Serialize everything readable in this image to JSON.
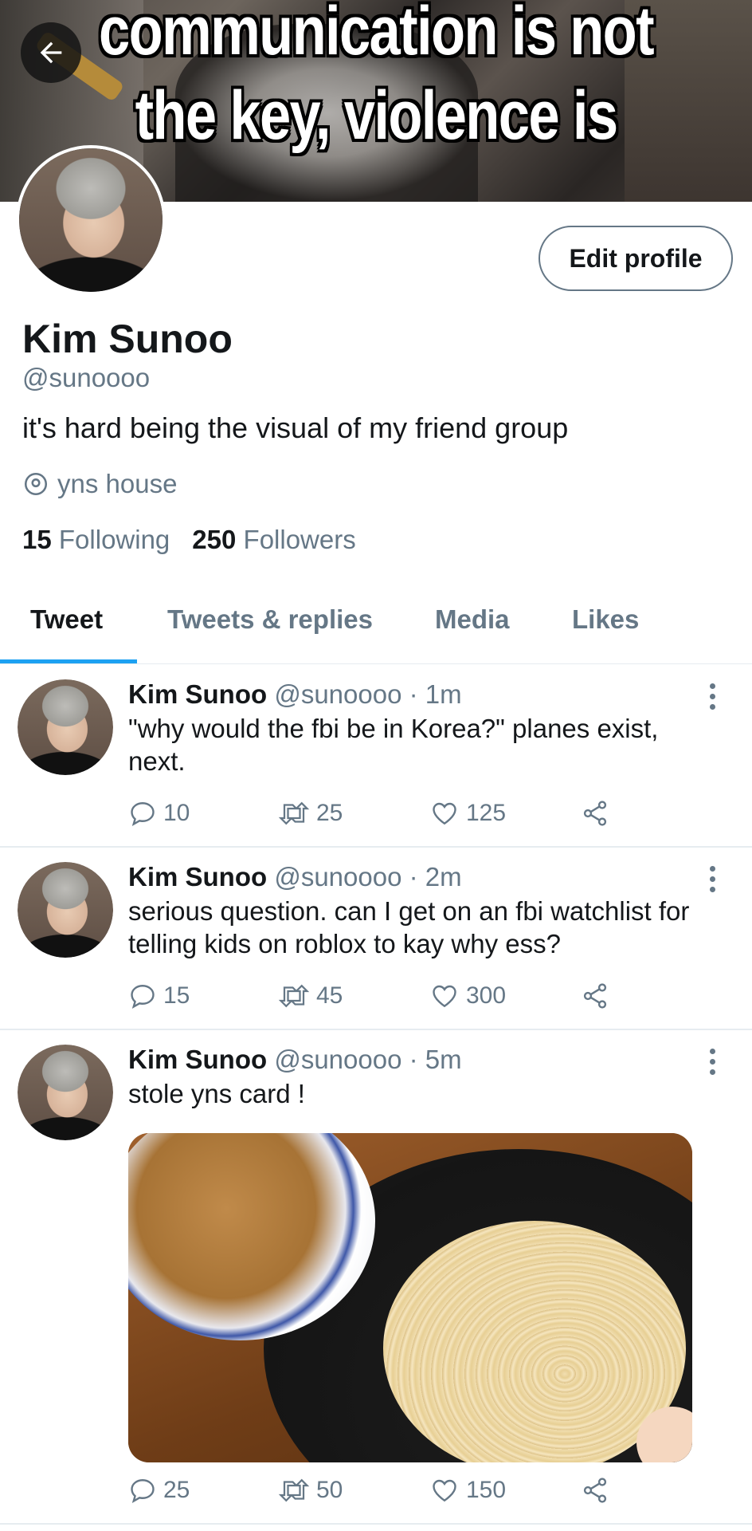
{
  "banner": {
    "line1": "communication is not",
    "line2": "the key, violence is"
  },
  "profile": {
    "edit_button": "Edit profile",
    "name": "Kim Sunoo",
    "handle": "@sunoooo",
    "bio": "it's hard being the visual of my friend group",
    "location": "yns house",
    "following_count": "15",
    "following_label": "Following",
    "followers_count": "250",
    "followers_label": "Followers"
  },
  "tabs": [
    "Tweet",
    "Tweets & replies",
    "Media",
    "Likes"
  ],
  "active_tab": "Tweet",
  "tweets": [
    {
      "name": "Kim Sunoo",
      "meta": "@sunoooo · 1m",
      "text": "\"why would the fbi be in Korea?\" planes exist, next.",
      "replies": "10",
      "retweets": "25",
      "likes": "125"
    },
    {
      "name": "Kim Sunoo",
      "meta": "@sunoooo · 2m",
      "text": "serious question. can I get on an fbi watchlist for telling kids on roblox to kay why ess?",
      "replies": "15",
      "retweets": "45",
      "likes": "300"
    },
    {
      "name": "Kim Sunoo",
      "meta": "@sunoooo · 5m",
      "text": "stole yns card !",
      "replies": "25",
      "retweets": "50",
      "likes": "150"
    }
  ],
  "colors": {
    "accent": "#1da1f2",
    "text_primary": "#14171a",
    "text_secondary": "#657786",
    "divider": "#e6ecf0"
  },
  "icons": [
    "back-arrow-icon",
    "location-pin-icon",
    "reply-icon",
    "retweet-icon",
    "like-icon",
    "share-icon",
    "more-options-icon"
  ]
}
